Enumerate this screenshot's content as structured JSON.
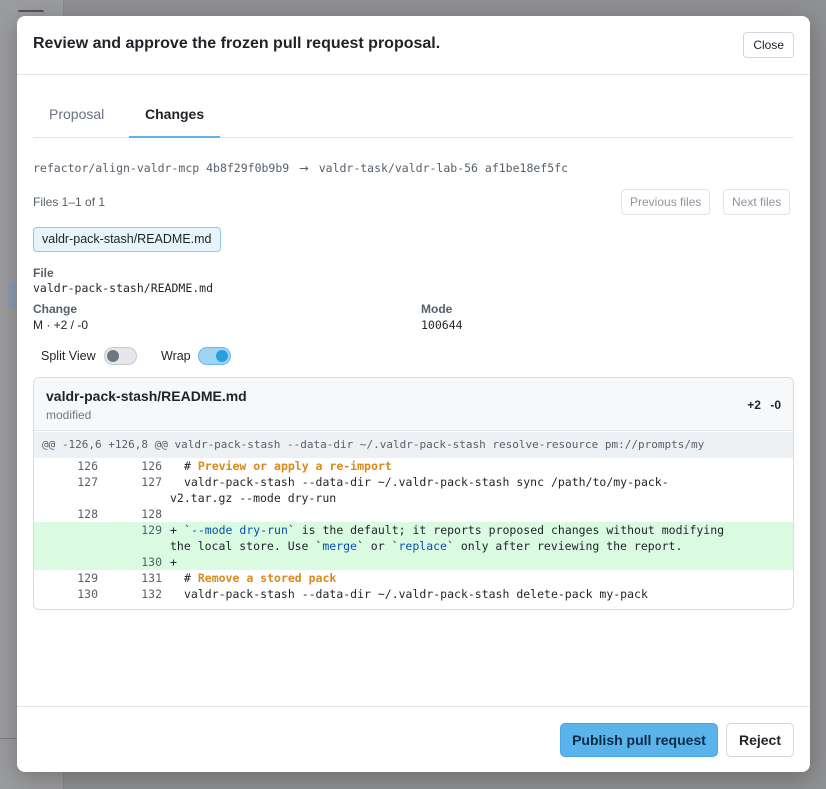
{
  "modal": {
    "title": "Review and approve the frozen pull request proposal.",
    "close_label": "Close"
  },
  "tabs": [
    {
      "label": "Proposal",
      "active": false
    },
    {
      "label": "Changes",
      "active": true
    }
  ],
  "refs": {
    "source_branch": "refactor/align-valdr-mcp",
    "source_sha": "4b8f29f0b9b9",
    "arrow": "→",
    "target_branch": "valdr-task/valdr-lab-56",
    "target_sha": "af1be18ef5fc"
  },
  "files": {
    "count_text": "Files 1–1 of 1",
    "previous_label": "Previous files",
    "next_label": "Next files",
    "chips": [
      "valdr-pack-stash/README.md"
    ]
  },
  "details": {
    "file_label": "File",
    "file_value": "valdr-pack-stash/README.md",
    "change_label": "Change",
    "change_value": "M · +2 / -0",
    "mode_label": "Mode",
    "mode_value": "100644"
  },
  "toggles": {
    "split_view_label": "Split View",
    "split_view_on": false,
    "wrap_label": "Wrap",
    "wrap_on": true
  },
  "diff": {
    "file_name": "valdr-pack-stash/README.md",
    "status": "modified",
    "additions": "+2",
    "deletions": "-0",
    "hunk_header": "@@ -126,6 +126,8 @@ valdr-pack-stash --data-dir ~/.valdr-pack-stash resolve-resource pm://prompts/my",
    "lines": [
      {
        "old": "126",
        "new": "126",
        "sign": "",
        "pre": "# ",
        "hl": "Preview or apply a re-import",
        "post": ""
      },
      {
        "old": "127",
        "new": "127",
        "sign": "",
        "text1": "valdr-pack-stash --data-dir ~/.valdr-pack-stash sync /path/to/my-pack-",
        "text2": "v2.tar.gz --mode dry-run"
      },
      {
        "old": "128",
        "new": "128",
        "sign": "",
        "text": ""
      },
      {
        "old": "",
        "new": "129",
        "sign": "+",
        "p1": "`",
        "b1": "--mode dry-run",
        "p2": "` is the default; it reports proposed changes without modifying",
        "p3": "the local store. Use `",
        "b2": "merge",
        "p4": "` or `",
        "b3": "replace",
        "p5": "` only after reviewing the report."
      },
      {
        "old": "",
        "new": "130",
        "sign": "+",
        "text": ""
      },
      {
        "old": "129",
        "new": "131",
        "sign": "",
        "pre": "# ",
        "hl": "Remove a stored pack",
        "post": ""
      },
      {
        "old": "130",
        "new": "132",
        "sign": "",
        "text": "valdr-pack-stash --data-dir ~/.valdr-pack-stash delete-pack my-pack"
      }
    ]
  },
  "footer": {
    "publish_label": "Publish pull request",
    "reject_label": "Reject"
  },
  "colors": {
    "accent": "#5bb3ec",
    "added_line_bg": "#dafbe1",
    "heading_highlight": "#d98a1a"
  }
}
